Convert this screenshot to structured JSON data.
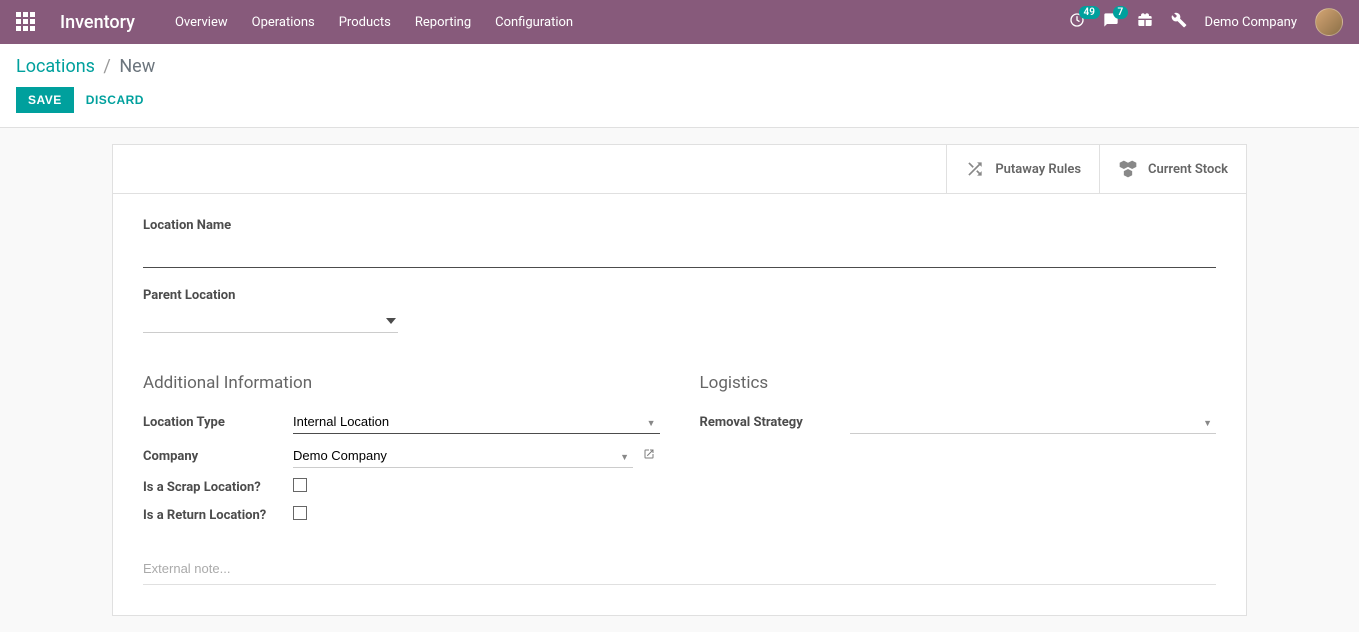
{
  "topbar": {
    "app_title": "Inventory",
    "nav": [
      "Overview",
      "Operations",
      "Products",
      "Reporting",
      "Configuration"
    ],
    "clock_badge": "49",
    "chat_badge": "7",
    "company": "Demo Company"
  },
  "breadcrumb": {
    "parent": "Locations",
    "current": "New"
  },
  "actions": {
    "save": "SAVE",
    "discard": "DISCARD"
  },
  "stat_buttons": {
    "putaway": "Putaway Rules",
    "stock": "Current Stock"
  },
  "form": {
    "location_name_label": "Location Name",
    "location_name_value": "",
    "parent_location_label": "Parent Location",
    "parent_location_value": "",
    "additional_info_title": "Additional Information",
    "logistics_title": "Logistics",
    "location_type_label": "Location Type",
    "location_type_value": "Internal Location",
    "company_label": "Company",
    "company_value": "Demo Company",
    "scrap_label": "Is a Scrap Location?",
    "return_label": "Is a Return Location?",
    "removal_label": "Removal Strategy",
    "removal_value": "",
    "note_placeholder": "External note..."
  }
}
